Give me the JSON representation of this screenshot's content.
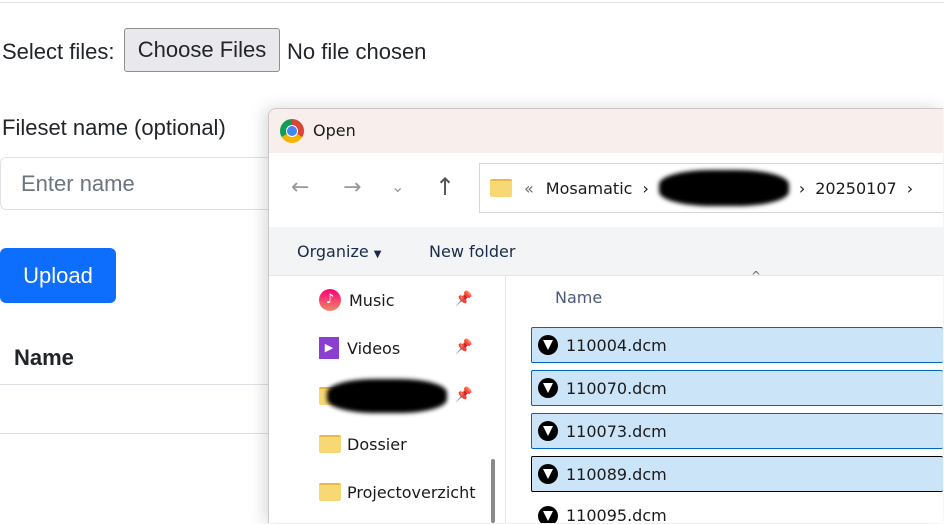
{
  "form": {
    "select_label": "Select files:",
    "choose_button": "Choose Files",
    "no_file": "No file chosen",
    "fileset_label": "Fileset name (optional)",
    "fileset_placeholder": "Enter name",
    "upload_button": "Upload",
    "table_header": "Name"
  },
  "dialog": {
    "title": "Open",
    "breadcrumb": {
      "overflow": "«",
      "items": [
        "Mosamatic",
        "20250107"
      ]
    },
    "toolbar": {
      "organize": "Organize",
      "new_folder": "New folder"
    },
    "nav_items": [
      {
        "label": "Music",
        "icon": "music-icon",
        "pinned": true
      },
      {
        "label": "Videos",
        "icon": "videos-icon",
        "pinned": true
      },
      {
        "label": "",
        "icon": "folder-icon",
        "pinned": true,
        "redacted": true
      },
      {
        "label": "Dossier",
        "icon": "folder-icon"
      },
      {
        "label": "Projectoverzicht",
        "icon": "folder-icon"
      }
    ],
    "column_header": "Name",
    "files": [
      {
        "name": "110004.dcm",
        "selected": true
      },
      {
        "name": "110070.dcm",
        "selected": true
      },
      {
        "name": "110073.dcm",
        "selected": true
      },
      {
        "name": "110089.dcm",
        "selected": true,
        "focused": true
      },
      {
        "name": "110095.dcm",
        "selected": false
      }
    ]
  },
  "colors": {
    "primary": "#0d6efd",
    "selection": "#cce4f7",
    "selection_border": "#0067c0"
  }
}
